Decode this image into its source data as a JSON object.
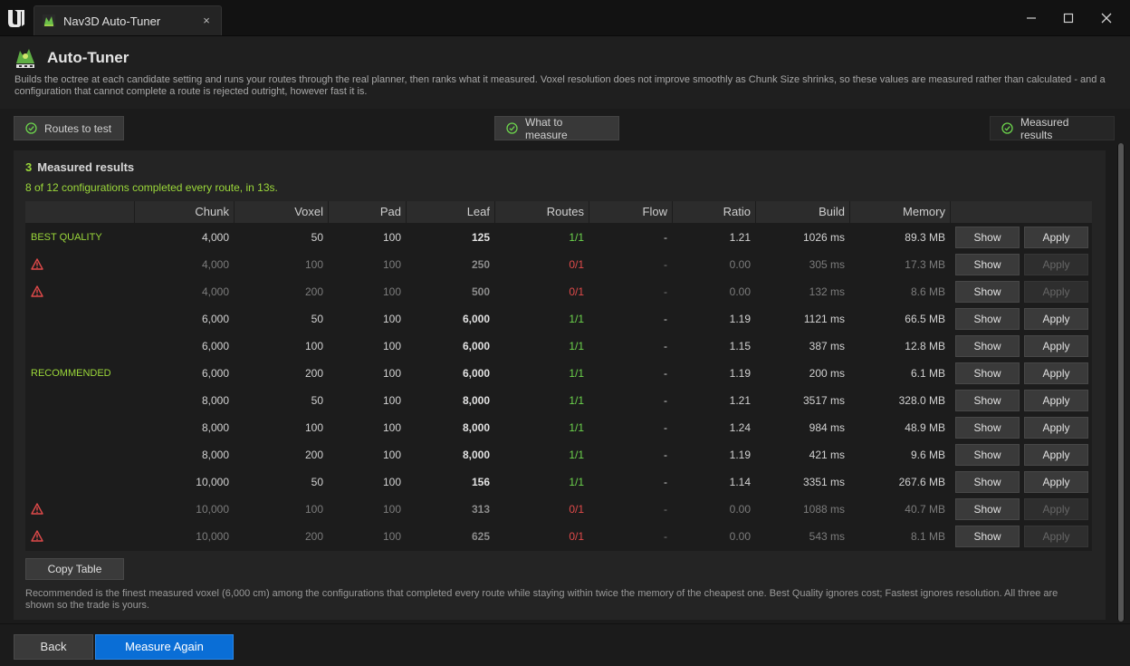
{
  "window": {
    "tab_title": "Nav3D Auto-Tuner",
    "tab_close": "×"
  },
  "header": {
    "title": "Auto-Tuner",
    "description": "Builds the octree at each candidate setting and runs your routes through the real planner, then ranks what it measured. Voxel resolution does not improve smoothly as Chunk Size shrinks, so these values are measured rather than calculated - and a configuration that cannot complete a route is rejected outright, however fast it is."
  },
  "steps": {
    "routes": "Routes to test",
    "measure": "What to measure",
    "results": "Measured results"
  },
  "results": {
    "step_number": "3",
    "heading": "Measured results",
    "summary": "8 of 12 configurations completed every route, in 13s.",
    "columns": [
      "Chunk",
      "Voxel",
      "Pad",
      "Leaf",
      "Routes",
      "Flow",
      "Ratio",
      "Build",
      "Memory"
    ],
    "rows": [
      {
        "label": "BEST QUALITY",
        "warn": false,
        "chunk": "4,000",
        "voxel": "50",
        "pad": "100",
        "leaf": "125",
        "routes": "1/1",
        "flow": "-",
        "ratio": "1.21",
        "build": "1026 ms",
        "memory": "89.3 MB",
        "show": "Show",
        "apply": "Apply",
        "ok": true
      },
      {
        "label": "",
        "warn": true,
        "chunk": "4,000",
        "voxel": "100",
        "pad": "100",
        "leaf": "250",
        "routes": "0/1",
        "flow": "-",
        "ratio": "0.00",
        "build": "305 ms",
        "memory": "17.3 MB",
        "show": "Show",
        "apply": "Apply",
        "ok": false
      },
      {
        "label": "",
        "warn": true,
        "chunk": "4,000",
        "voxel": "200",
        "pad": "100",
        "leaf": "500",
        "routes": "0/1",
        "flow": "-",
        "ratio": "0.00",
        "build": "132 ms",
        "memory": "8.6 MB",
        "show": "Show",
        "apply": "Apply",
        "ok": false
      },
      {
        "label": "",
        "warn": false,
        "chunk": "6,000",
        "voxel": "50",
        "pad": "100",
        "leaf": "6,000",
        "routes": "1/1",
        "flow": "-",
        "ratio": "1.19",
        "build": "1121 ms",
        "memory": "66.5 MB",
        "show": "Show",
        "apply": "Apply",
        "ok": true
      },
      {
        "label": "",
        "warn": false,
        "chunk": "6,000",
        "voxel": "100",
        "pad": "100",
        "leaf": "6,000",
        "routes": "1/1",
        "flow": "-",
        "ratio": "1.15",
        "build": "387 ms",
        "memory": "12.8 MB",
        "show": "Show",
        "apply": "Apply",
        "ok": true
      },
      {
        "label": "RECOMMENDED",
        "warn": false,
        "chunk": "6,000",
        "voxel": "200",
        "pad": "100",
        "leaf": "6,000",
        "routes": "1/1",
        "flow": "-",
        "ratio": "1.19",
        "build": "200 ms",
        "memory": "6.1 MB",
        "show": "Show",
        "apply": "Apply",
        "ok": true
      },
      {
        "label": "",
        "warn": false,
        "chunk": "8,000",
        "voxel": "50",
        "pad": "100",
        "leaf": "8,000",
        "routes": "1/1",
        "flow": "-",
        "ratio": "1.21",
        "build": "3517 ms",
        "memory": "328.0 MB",
        "show": "Show",
        "apply": "Apply",
        "ok": true
      },
      {
        "label": "",
        "warn": false,
        "chunk": "8,000",
        "voxel": "100",
        "pad": "100",
        "leaf": "8,000",
        "routes": "1/1",
        "flow": "-",
        "ratio": "1.24",
        "build": "984 ms",
        "memory": "48.9 MB",
        "show": "Show",
        "apply": "Apply",
        "ok": true
      },
      {
        "label": "",
        "warn": false,
        "chunk": "8,000",
        "voxel": "200",
        "pad": "100",
        "leaf": "8,000",
        "routes": "1/1",
        "flow": "-",
        "ratio": "1.19",
        "build": "421 ms",
        "memory": "9.6 MB",
        "show": "Show",
        "apply": "Apply",
        "ok": true
      },
      {
        "label": "",
        "warn": false,
        "chunk": "10,000",
        "voxel": "50",
        "pad": "100",
        "leaf": "156",
        "routes": "1/1",
        "flow": "-",
        "ratio": "1.14",
        "build": "3351 ms",
        "memory": "267.6 MB",
        "show": "Show",
        "apply": "Apply",
        "ok": true
      },
      {
        "label": "",
        "warn": true,
        "chunk": "10,000",
        "voxel": "100",
        "pad": "100",
        "leaf": "313",
        "routes": "0/1",
        "flow": "-",
        "ratio": "0.00",
        "build": "1088 ms",
        "memory": "40.7 MB",
        "show": "Show",
        "apply": "Apply",
        "ok": false
      },
      {
        "label": "",
        "warn": true,
        "chunk": "10,000",
        "voxel": "200",
        "pad": "100",
        "leaf": "625",
        "routes": "0/1",
        "flow": "-",
        "ratio": "0.00",
        "build": "543 ms",
        "memory": "8.1 MB",
        "show": "Show",
        "apply": "Apply",
        "ok": false
      }
    ],
    "copy_label": "Copy Table",
    "footnote": "Recommended is the finest measured voxel (6,000 cm) among the configurations that completed every route while staying within twice the memory of the cheapest one. Best Quality ignores cost; Fastest ignores resolution. All three are shown so the trade is yours."
  },
  "footer": {
    "back_label": "Back",
    "measure_label": "Measure Again"
  },
  "colors": {
    "accent_blue": "#0a6ed6",
    "success_green": "#6cd34c",
    "label_green": "#9bd83a",
    "fail_red": "#e04a4a"
  }
}
